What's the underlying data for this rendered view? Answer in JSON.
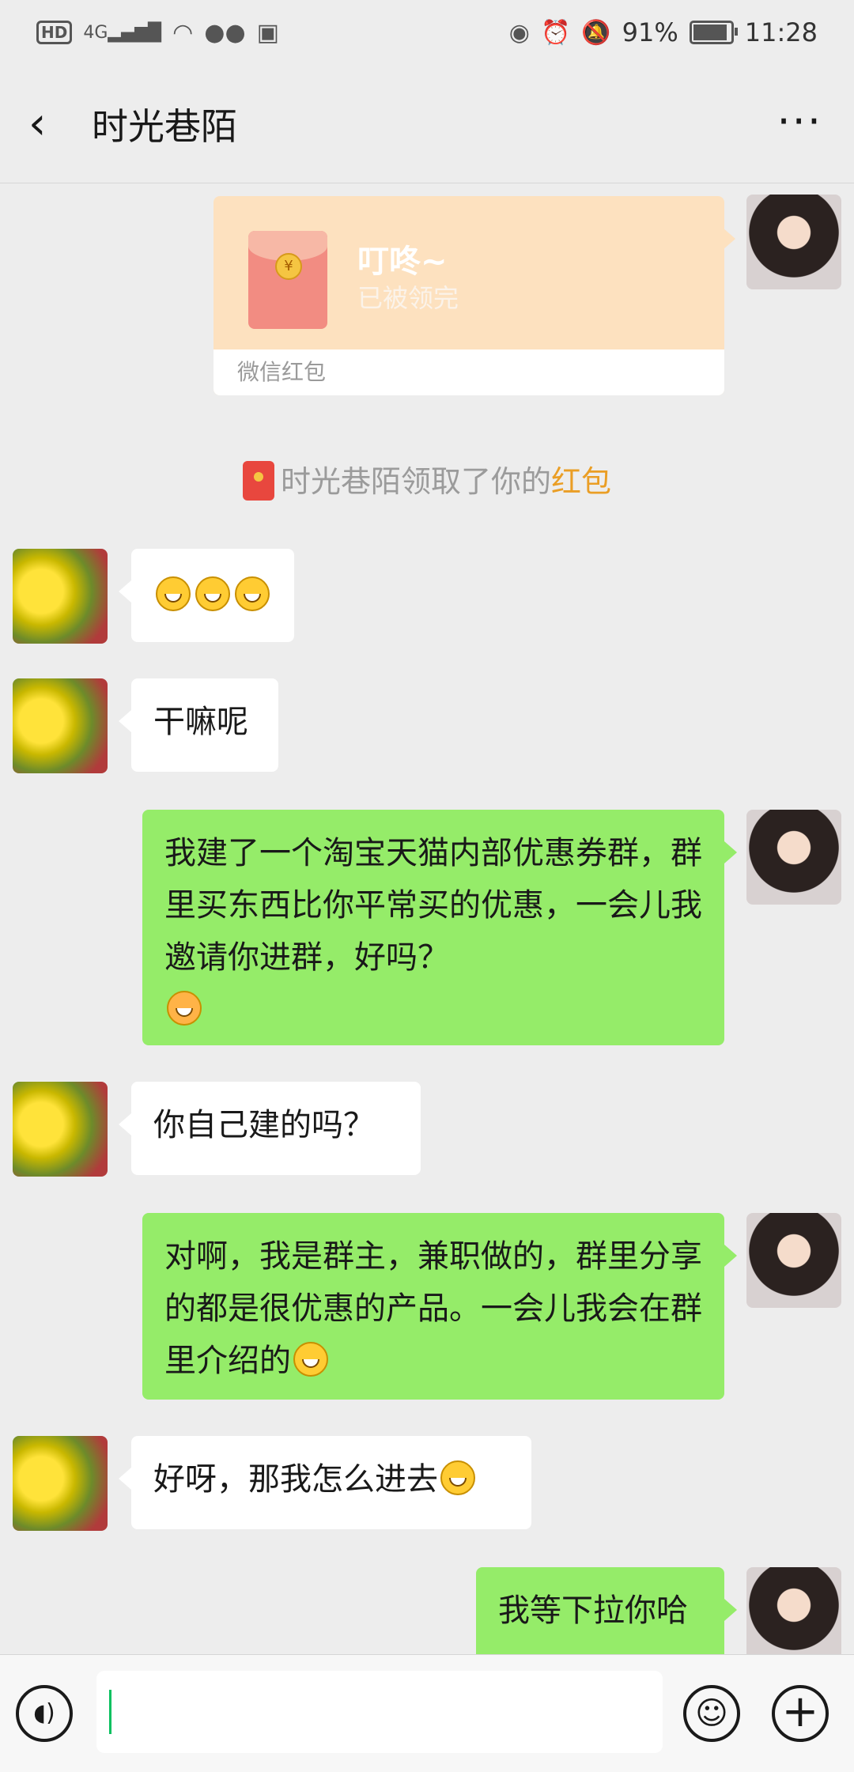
{
  "status_bar": {
    "left_badges": [
      "HD",
      "4G"
    ],
    "battery": "91%",
    "battery_level": 0.91,
    "time": "11:28",
    "icons": [
      "signal-icon",
      "wifi-icon",
      "wechat-icon",
      "app-icon",
      "eye-icon",
      "alarm-icon",
      "mute-icon",
      "battery-icon"
    ]
  },
  "header": {
    "back_label": "‹",
    "title": "时光巷陌",
    "more_label": "···"
  },
  "red_packet": {
    "title": "叮咚~",
    "status": "已被领完",
    "footer": "微信红包"
  },
  "system_message": {
    "text_before": "时光巷陌领取了你的",
    "highlight": "红包"
  },
  "messages": [
    {
      "side": "left",
      "text": ""
    },
    {
      "side": "left",
      "text": "干嘛呢"
    },
    {
      "side": "right",
      "text": "我建了一个淘宝天猫内部优惠券群，群里买东西比你平常买的优惠，一会儿我邀请你进群，好吗？"
    },
    {
      "side": "left",
      "text": "你自己建的吗？"
    },
    {
      "side": "right",
      "text": "对啊，我是群主，兼职做的，群里分享的都是很优惠的产品。一会儿我会在群里介绍的"
    },
    {
      "side": "left",
      "text": "好呀，那我怎么进去"
    },
    {
      "side": "right",
      "text": "我等下拉你哈"
    }
  ],
  "input": {
    "placeholder": ""
  }
}
